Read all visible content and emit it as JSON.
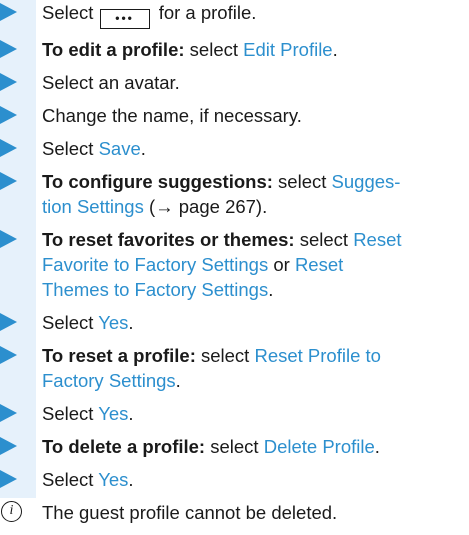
{
  "steps": [
    {
      "parts": [
        {
          "t": "Select "
        },
        {
          "t": "•••",
          "kind": "button"
        },
        {
          "t": " for a profile."
        }
      ]
    },
    {
      "parts": [
        {
          "t": "To edit a profile:",
          "kind": "bold"
        },
        {
          "t": " select "
        },
        {
          "t": "Edit Profile",
          "kind": "link"
        },
        {
          "t": "."
        }
      ]
    },
    {
      "parts": [
        {
          "t": "Select an avatar."
        }
      ]
    },
    {
      "parts": [
        {
          "t": "Change the name, if necessary."
        }
      ]
    },
    {
      "parts": [
        {
          "t": "Select "
        },
        {
          "t": "Save",
          "kind": "link"
        },
        {
          "t": "."
        }
      ]
    },
    {
      "parts": [
        {
          "t": "To configure suggestions:",
          "kind": "bold"
        },
        {
          "t": " select "
        },
        {
          "t": "Sugges-\ntion Settings",
          "kind": "link"
        },
        {
          "t": " (→ page 267)."
        }
      ]
    },
    {
      "parts": [
        {
          "t": "To reset favorites or themes:",
          "kind": "bold"
        },
        {
          "t": " select "
        },
        {
          "t": "Reset\nFavorite to Factory Settings",
          "kind": "link"
        },
        {
          "t": " or "
        },
        {
          "t": "Reset\nThemes to Factory Settings",
          "kind": "link"
        },
        {
          "t": "."
        }
      ]
    },
    {
      "parts": [
        {
          "t": "Select "
        },
        {
          "t": "Yes",
          "kind": "link"
        },
        {
          "t": "."
        }
      ]
    },
    {
      "parts": [
        {
          "t": "To reset a profile:",
          "kind": "bold"
        },
        {
          "t": " select "
        },
        {
          "t": "Reset Profile to\nFactory Settings",
          "kind": "link"
        },
        {
          "t": "."
        }
      ]
    },
    {
      "parts": [
        {
          "t": "Select "
        },
        {
          "t": "Yes",
          "kind": "link"
        },
        {
          "t": "."
        }
      ]
    },
    {
      "parts": [
        {
          "t": "To delete a profile:",
          "kind": "bold"
        },
        {
          "t": " select "
        },
        {
          "t": "Delete Profile",
          "kind": "link"
        },
        {
          "t": "."
        }
      ]
    },
    {
      "parts": [
        {
          "t": "Select "
        },
        {
          "t": "Yes",
          "kind": "link"
        },
        {
          "t": "."
        }
      ]
    }
  ],
  "note": {
    "icon": "info-icon",
    "icon_glyph": "i",
    "text": "The guest profile cannot be deleted."
  },
  "colors": {
    "accent": "#2c8fce",
    "sidebar": "#e6f1fb",
    "text": "#1a1a1a"
  }
}
